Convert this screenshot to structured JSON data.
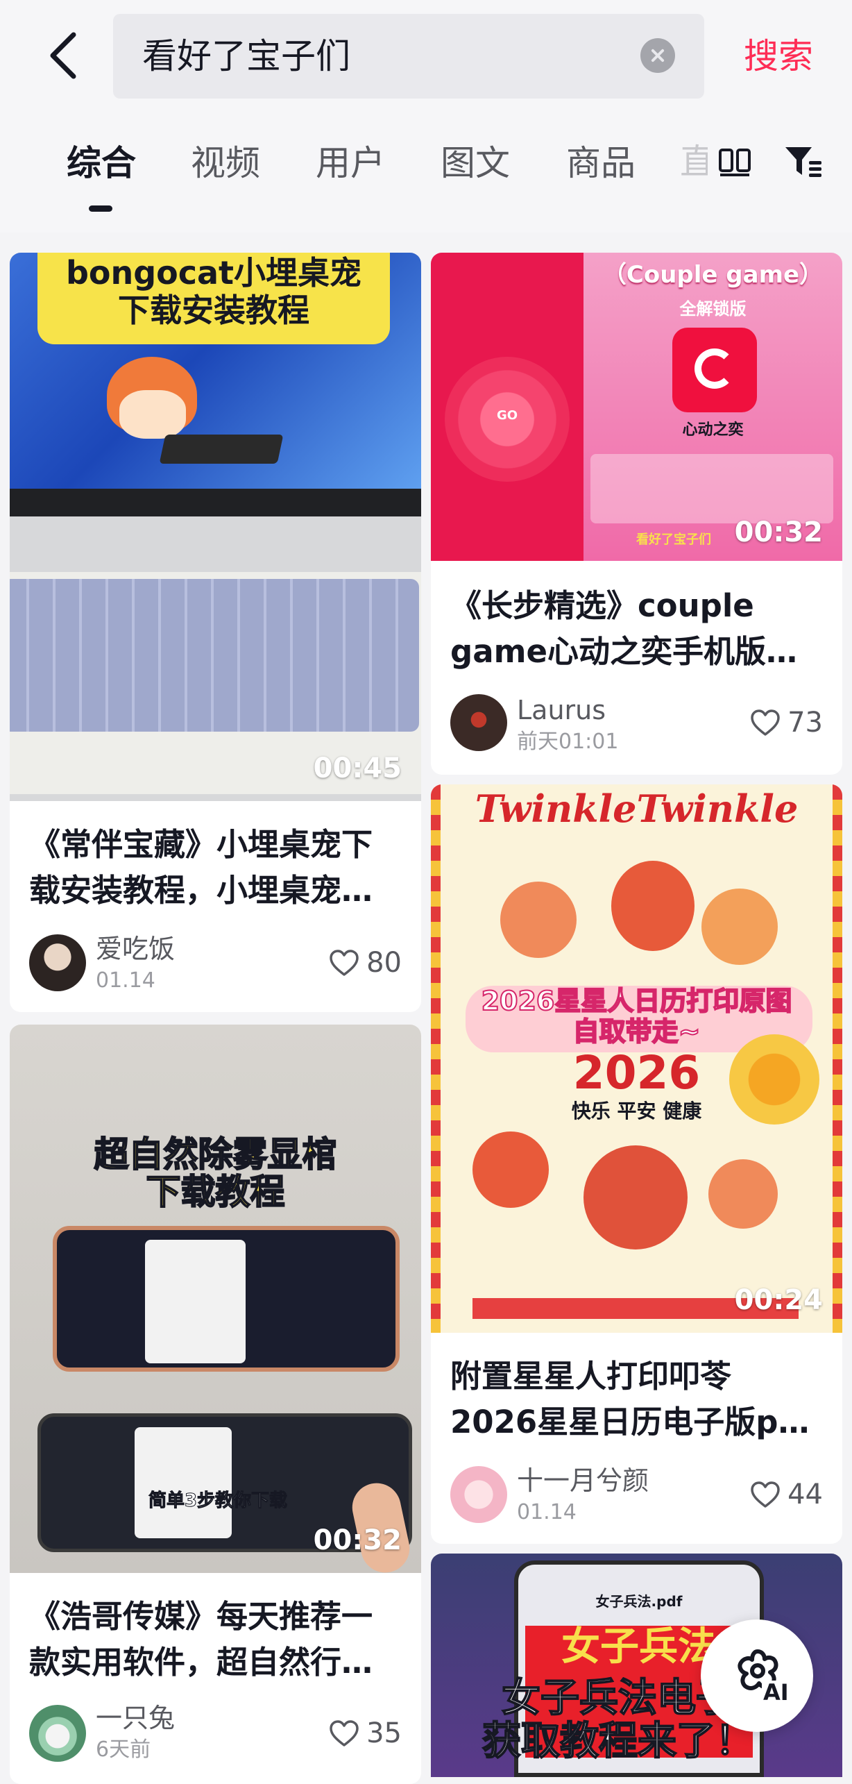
{
  "search": {
    "query": "看好了宝子们",
    "button_label": "搜索"
  },
  "tabs": [
    {
      "label": "综合",
      "active": true
    },
    {
      "label": "视频",
      "active": false
    },
    {
      "label": "用户",
      "active": false
    },
    {
      "label": "图文",
      "active": false
    },
    {
      "label": "商品",
      "active": false
    },
    {
      "label": "直",
      "active": false
    }
  ],
  "feed": [
    {
      "thumb_text_1": "bongocat小埋桌宠",
      "thumb_text_2": "下载安装教程",
      "duration": "00:45",
      "title_line_1": "《常伴宝藏》小埋桌宠下",
      "title_line_2": "载安装教程，小埋桌宠…",
      "author": "爱吃饭",
      "time": "01.14",
      "likes": "80"
    },
    {
      "thumb_text_1": "（Couple game）",
      "thumb_text_2": "全解锁版",
      "thumb_text_3": "心动之奕",
      "thumb_text_4": "看好了宝子们",
      "thumb_text_5": "GO",
      "duration": "00:32",
      "title_line_1": "《长步精选》couple",
      "title_line_2": "game心动之奕手机版…",
      "author": "Laurus",
      "time": "前天01:01",
      "likes": "73"
    },
    {
      "thumb_text_1": "超自然除雾显棺",
      "thumb_text_2": "下载教程",
      "thumb_text_3": "简单3步教你下载",
      "duration": "00:32",
      "title_line_1": "《浩哥传媒》每天推荐一",
      "title_line_2": "款实用软件，超自然行…",
      "author": "一只兔",
      "time": "6天前",
      "likes": "35"
    },
    {
      "thumb_text_1": "TwinkleTwinkle",
      "thumb_text_2": "2026星星人日历打印原图",
      "thumb_text_3": "自取带走~",
      "thumb_text_4": "2026",
      "thumb_text_5": "快乐 平安 健康",
      "duration": "00:24",
      "title_line_1": "附置星星人打印叩苓",
      "title_line_2": "2026星星日历电子版p…",
      "author": "十一月兮颜",
      "time": "01.14",
      "likes": "44"
    },
    {
      "thumb_text_1": "女子兵法.pdf",
      "thumb_text_2": "女子兵法电子",
      "thumb_text_3": "获取教程来了！",
      "thumb_text_4": "女子兵法"
    }
  ],
  "ai_button": {
    "label": "AI"
  },
  "colors": {
    "accent": "#fe2c55",
    "text": "#161823",
    "secondary": "#58595f"
  }
}
